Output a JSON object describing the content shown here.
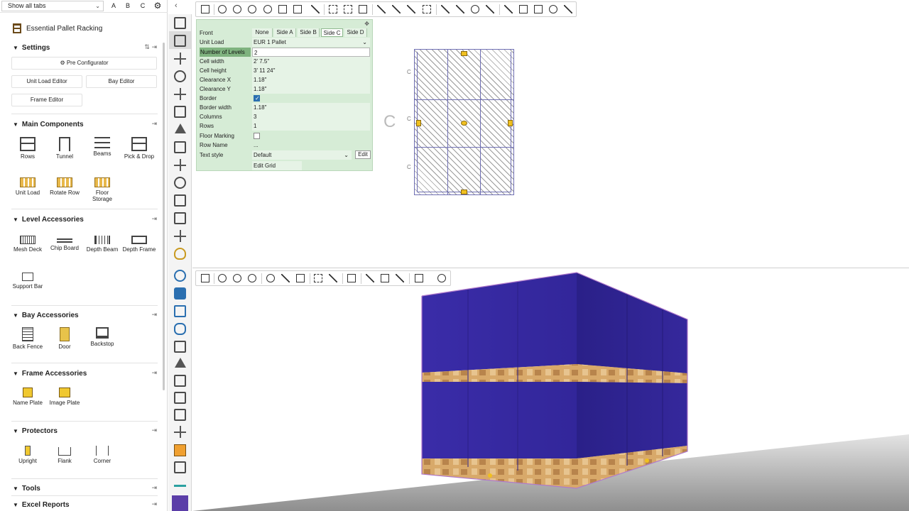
{
  "tabs_filter": {
    "selected": "Show all tabs",
    "letters": [
      "A",
      "B",
      "C"
    ]
  },
  "panel": {
    "title": "Essential Pallet Racking",
    "settings": {
      "title": "Settings",
      "buttons": {
        "pre_configurator": "Pre Configurator",
        "unit_load_editor": "Unit Load Editor",
        "bay_editor": "Bay Editor",
        "frame_editor": "Frame Editor"
      }
    },
    "main_components": {
      "title": "Main Components",
      "items": [
        "Rows",
        "Tunnel",
        "Beams",
        "Pick & Drop",
        "Unit Load",
        "Rotate Row",
        "Floor Storage"
      ]
    },
    "level_accessories": {
      "title": "Level Accessories",
      "items": [
        "Mesh Deck",
        "Chip Board",
        "Depth Beam",
        "Depth Frame",
        "Support Bar"
      ]
    },
    "bay_accessories": {
      "title": "Bay Accessories",
      "items": [
        "Back Fence",
        "Door",
        "Backstop"
      ]
    },
    "frame_accessories": {
      "title": "Frame Accessories",
      "items": [
        "Name Plate",
        "Image Plate"
      ]
    },
    "protectors": {
      "title": "Protectors",
      "items": [
        "Upright",
        "Flank",
        "Corner"
      ]
    },
    "tools": {
      "title": "Tools"
    },
    "excel_reports": {
      "title": "Excel Reports"
    }
  },
  "properties": {
    "front": {
      "label": "Front",
      "options": [
        "None",
        "Side A",
        "Side B",
        "Side C",
        "Side D"
      ],
      "selected": "Side C"
    },
    "rows": [
      {
        "label": "Unit Load",
        "value": "EUR 1 Pallet"
      },
      {
        "label": "Number of Levels",
        "value": "2"
      },
      {
        "label": "Cell width",
        "value": "2' 7.5\""
      },
      {
        "label": "Cell height",
        "value": "3' 11 24\""
      },
      {
        "label": "Clearance X",
        "value": "1.18\""
      },
      {
        "label": "Clearance Y",
        "value": "1.18\""
      },
      {
        "label": "Border",
        "value": ""
      },
      {
        "label": "Border width",
        "value": "1.18\""
      },
      {
        "label": "Columns",
        "value": "3"
      },
      {
        "label": "Rows",
        "value": "1"
      },
      {
        "label": "Floor Marking",
        "value": ""
      },
      {
        "label": "Row Name",
        "value": "..."
      },
      {
        "label": "Text style",
        "value": "Default"
      }
    ],
    "border_checked": true,
    "floor_marking_checked": false,
    "edit_label": "Edit",
    "edit_grid_label": "Edit Grid"
  },
  "plan_view": {
    "side_label": "C"
  },
  "colors": {
    "panel_green": "#d6ecd6",
    "wrap_blue": "#3b2da6",
    "pallet_wood": "#d8a96a",
    "selected_icon": "#5b3ea8"
  },
  "icons": [
    "hand-icon",
    "zoom-icon",
    "zoom-in-icon",
    "zoom-out-icon",
    "fit-icon",
    "measure-icon",
    "close-icon"
  ]
}
